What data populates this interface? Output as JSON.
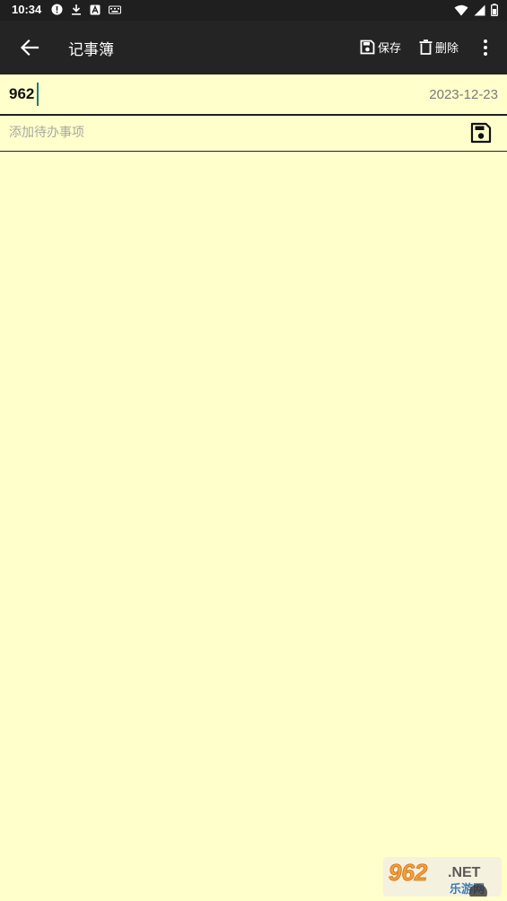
{
  "status_bar": {
    "time": "10:34"
  },
  "toolbar": {
    "title": "记事簿",
    "save_label": "保存",
    "delete_label": "删除"
  },
  "note": {
    "title": "962",
    "date": "2023-12-23"
  },
  "todo": {
    "placeholder": "添加待办事项",
    "value": ""
  },
  "watermark": {
    "logo_text": "962.NET",
    "logo_subtext": "乐游网"
  },
  "colors": {
    "background": "#FFFFCC",
    "toolbar": "#242424",
    "status_bar": "#1f1f1f",
    "caret": "#1a7f7a",
    "date_text": "#7a7a7a"
  }
}
